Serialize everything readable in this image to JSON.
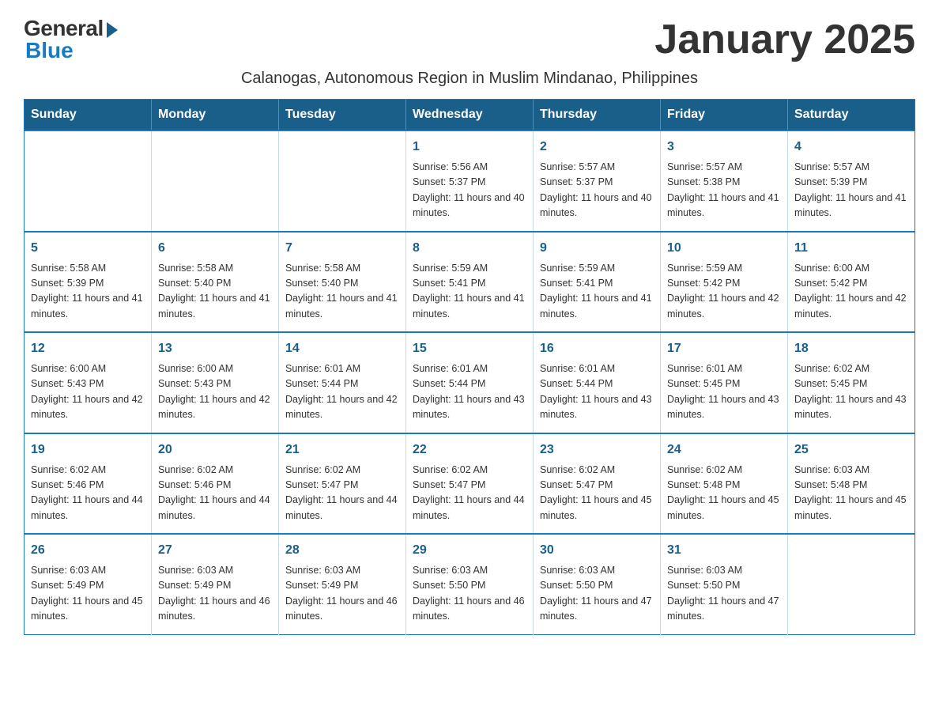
{
  "logo": {
    "general": "General",
    "blue": "Blue"
  },
  "title": "January 2025",
  "subtitle": "Calanogas, Autonomous Region in Muslim Mindanao, Philippines",
  "header": {
    "days": [
      "Sunday",
      "Monday",
      "Tuesday",
      "Wednesday",
      "Thursday",
      "Friday",
      "Saturday"
    ]
  },
  "weeks": [
    [
      {
        "day": "",
        "info": ""
      },
      {
        "day": "",
        "info": ""
      },
      {
        "day": "",
        "info": ""
      },
      {
        "day": "1",
        "info": "Sunrise: 5:56 AM\nSunset: 5:37 PM\nDaylight: 11 hours and 40 minutes."
      },
      {
        "day": "2",
        "info": "Sunrise: 5:57 AM\nSunset: 5:37 PM\nDaylight: 11 hours and 40 minutes."
      },
      {
        "day": "3",
        "info": "Sunrise: 5:57 AM\nSunset: 5:38 PM\nDaylight: 11 hours and 41 minutes."
      },
      {
        "day": "4",
        "info": "Sunrise: 5:57 AM\nSunset: 5:39 PM\nDaylight: 11 hours and 41 minutes."
      }
    ],
    [
      {
        "day": "5",
        "info": "Sunrise: 5:58 AM\nSunset: 5:39 PM\nDaylight: 11 hours and 41 minutes."
      },
      {
        "day": "6",
        "info": "Sunrise: 5:58 AM\nSunset: 5:40 PM\nDaylight: 11 hours and 41 minutes."
      },
      {
        "day": "7",
        "info": "Sunrise: 5:58 AM\nSunset: 5:40 PM\nDaylight: 11 hours and 41 minutes."
      },
      {
        "day": "8",
        "info": "Sunrise: 5:59 AM\nSunset: 5:41 PM\nDaylight: 11 hours and 41 minutes."
      },
      {
        "day": "9",
        "info": "Sunrise: 5:59 AM\nSunset: 5:41 PM\nDaylight: 11 hours and 41 minutes."
      },
      {
        "day": "10",
        "info": "Sunrise: 5:59 AM\nSunset: 5:42 PM\nDaylight: 11 hours and 42 minutes."
      },
      {
        "day": "11",
        "info": "Sunrise: 6:00 AM\nSunset: 5:42 PM\nDaylight: 11 hours and 42 minutes."
      }
    ],
    [
      {
        "day": "12",
        "info": "Sunrise: 6:00 AM\nSunset: 5:43 PM\nDaylight: 11 hours and 42 minutes."
      },
      {
        "day": "13",
        "info": "Sunrise: 6:00 AM\nSunset: 5:43 PM\nDaylight: 11 hours and 42 minutes."
      },
      {
        "day": "14",
        "info": "Sunrise: 6:01 AM\nSunset: 5:44 PM\nDaylight: 11 hours and 42 minutes."
      },
      {
        "day": "15",
        "info": "Sunrise: 6:01 AM\nSunset: 5:44 PM\nDaylight: 11 hours and 43 minutes."
      },
      {
        "day": "16",
        "info": "Sunrise: 6:01 AM\nSunset: 5:44 PM\nDaylight: 11 hours and 43 minutes."
      },
      {
        "day": "17",
        "info": "Sunrise: 6:01 AM\nSunset: 5:45 PM\nDaylight: 11 hours and 43 minutes."
      },
      {
        "day": "18",
        "info": "Sunrise: 6:02 AM\nSunset: 5:45 PM\nDaylight: 11 hours and 43 minutes."
      }
    ],
    [
      {
        "day": "19",
        "info": "Sunrise: 6:02 AM\nSunset: 5:46 PM\nDaylight: 11 hours and 44 minutes."
      },
      {
        "day": "20",
        "info": "Sunrise: 6:02 AM\nSunset: 5:46 PM\nDaylight: 11 hours and 44 minutes."
      },
      {
        "day": "21",
        "info": "Sunrise: 6:02 AM\nSunset: 5:47 PM\nDaylight: 11 hours and 44 minutes."
      },
      {
        "day": "22",
        "info": "Sunrise: 6:02 AM\nSunset: 5:47 PM\nDaylight: 11 hours and 44 minutes."
      },
      {
        "day": "23",
        "info": "Sunrise: 6:02 AM\nSunset: 5:47 PM\nDaylight: 11 hours and 45 minutes."
      },
      {
        "day": "24",
        "info": "Sunrise: 6:02 AM\nSunset: 5:48 PM\nDaylight: 11 hours and 45 minutes."
      },
      {
        "day": "25",
        "info": "Sunrise: 6:03 AM\nSunset: 5:48 PM\nDaylight: 11 hours and 45 minutes."
      }
    ],
    [
      {
        "day": "26",
        "info": "Sunrise: 6:03 AM\nSunset: 5:49 PM\nDaylight: 11 hours and 45 minutes."
      },
      {
        "day": "27",
        "info": "Sunrise: 6:03 AM\nSunset: 5:49 PM\nDaylight: 11 hours and 46 minutes."
      },
      {
        "day": "28",
        "info": "Sunrise: 6:03 AM\nSunset: 5:49 PM\nDaylight: 11 hours and 46 minutes."
      },
      {
        "day": "29",
        "info": "Sunrise: 6:03 AM\nSunset: 5:50 PM\nDaylight: 11 hours and 46 minutes."
      },
      {
        "day": "30",
        "info": "Sunrise: 6:03 AM\nSunset: 5:50 PM\nDaylight: 11 hours and 47 minutes."
      },
      {
        "day": "31",
        "info": "Sunrise: 6:03 AM\nSunset: 5:50 PM\nDaylight: 11 hours and 47 minutes."
      },
      {
        "day": "",
        "info": ""
      }
    ]
  ]
}
